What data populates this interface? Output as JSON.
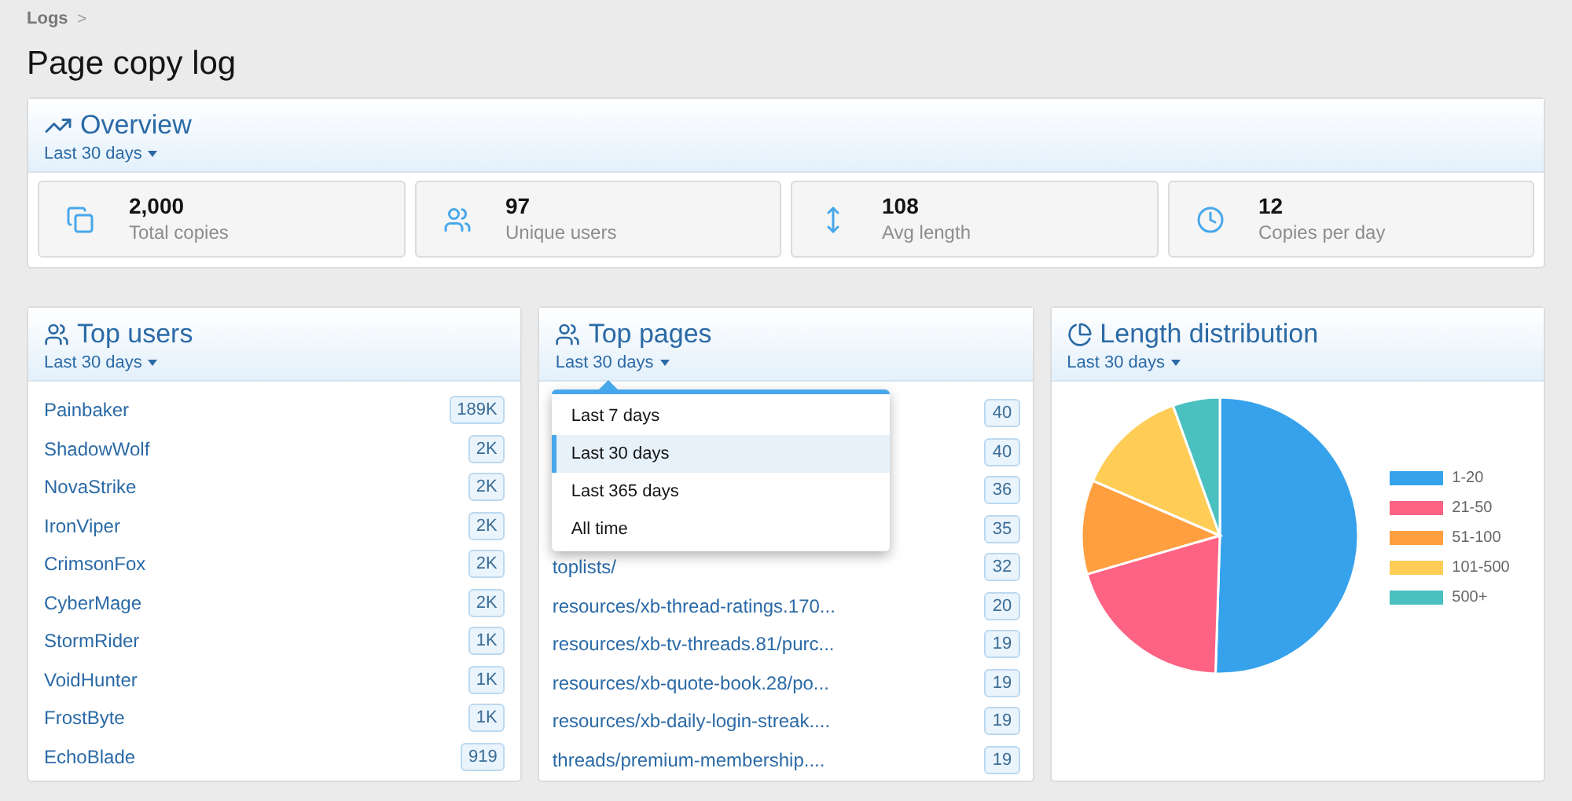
{
  "breadcrumb": [
    {
      "label": "Logs",
      "separator": ">"
    }
  ],
  "title": "Page copy log",
  "overview": {
    "title": "Overview",
    "filter": "Last 30 days",
    "stats": [
      {
        "kind": "copies",
        "value": "2,000",
        "label": "Total copies"
      },
      {
        "kind": "users",
        "value": "97",
        "label": "Unique users"
      },
      {
        "kind": "length",
        "value": "108",
        "label": "Avg length"
      },
      {
        "kind": "clock",
        "value": "12",
        "label": "Copies per day"
      }
    ]
  },
  "top_users": {
    "title": "Top users",
    "filter": "Last 30 days",
    "rows": [
      {
        "label": "Painbaker",
        "count": "189K"
      },
      {
        "label": "ShadowWolf",
        "count": "2K"
      },
      {
        "label": "NovaStrike",
        "count": "2K"
      },
      {
        "label": "IronViper",
        "count": "2K"
      },
      {
        "label": "CrimsonFox",
        "count": "2K"
      },
      {
        "label": "CyberMage",
        "count": "2K"
      },
      {
        "label": "StormRider",
        "count": "1K"
      },
      {
        "label": "VoidHunter",
        "count": "1K"
      },
      {
        "label": "FrostByte",
        "count": "1K"
      },
      {
        "label": "EchoBlade",
        "count": "919"
      }
    ]
  },
  "top_pages": {
    "title": "Top pages",
    "filter": "Last 30 days",
    "rows": [
      {
        "count": "40"
      },
      {
        "count": "40"
      },
      {
        "count": "36"
      },
      {
        "count": "35"
      },
      {
        "label": "toplists/",
        "count": "32"
      },
      {
        "label": "resources/xb-thread-ratings.170...",
        "count": "20"
      },
      {
        "label": "resources/xb-tv-threads.81/purc...",
        "count": "19"
      },
      {
        "label": "resources/xb-quote-book.28/po...",
        "count": "19"
      },
      {
        "label": "resources/xb-daily-login-streak....",
        "count": "19"
      },
      {
        "label": "threads/premium-membership....",
        "count": "19"
      }
    ],
    "menu": [
      {
        "label": "Last 7 days",
        "selected": false
      },
      {
        "label": "Last 30 days",
        "selected": true
      },
      {
        "label": "Last 365 days",
        "selected": false
      },
      {
        "label": "All time",
        "selected": false
      }
    ]
  },
  "length_distribution": {
    "title": "Length distribution",
    "filter": "Last 30 days",
    "legend": [
      {
        "label": "1-20",
        "color": "#36a2eb"
      },
      {
        "label": "21-50",
        "color": "#ff6384"
      },
      {
        "label": "51-100",
        "color": "#ff9f40"
      },
      {
        "label": "101-500",
        "color": "#ffcd56"
      },
      {
        "label": "500+",
        "color": "#4bc0c0"
      }
    ]
  }
}
